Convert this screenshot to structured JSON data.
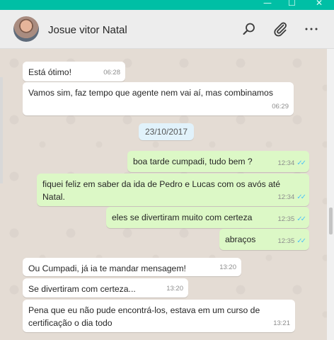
{
  "window": {
    "controls": [
      "—",
      "☐",
      "✕"
    ]
  },
  "header": {
    "contact_name": "Josue vitor Natal",
    "icons": [
      "search-icon",
      "attach-icon",
      "menu-icon"
    ]
  },
  "chat": {
    "date_divider": "23/10/2017",
    "messages": [
      {
        "dir": "in",
        "text": "Está ótimo!",
        "time": "06:28"
      },
      {
        "dir": "in",
        "text": "Vamos sim, faz tempo que agente nem vai aí, mas combinamos",
        "time": "06:29"
      },
      {
        "dir": "out",
        "text": "boa tarde cumpadi, tudo bem ?",
        "time": "12:34"
      },
      {
        "dir": "out",
        "text": "fiquei feliz em saber da ida de Pedro e Lucas com os avós até Natal.",
        "time": "12:34"
      },
      {
        "dir": "out",
        "text": "eles se divertiram muito com certeza",
        "time": "12:35"
      },
      {
        "dir": "out",
        "text": "abraços",
        "time": "12:35"
      },
      {
        "dir": "in",
        "text": "Ou Cumpadi, já ia te mandar mensagem!",
        "time": "13:20"
      },
      {
        "dir": "in",
        "text": "Se divertiram com certeza...",
        "time": "13:20"
      },
      {
        "dir": "in",
        "text": "Pena que eu não pude encontrá-los, estava em um curso de certificação o dia todo",
        "time": "13:21"
      }
    ]
  },
  "colors": {
    "accent": "#00bfa5",
    "outgoing_bubble": "#dcf8c6",
    "incoming_bubble": "#ffffff",
    "read_ticks": "#4fc3f7"
  }
}
